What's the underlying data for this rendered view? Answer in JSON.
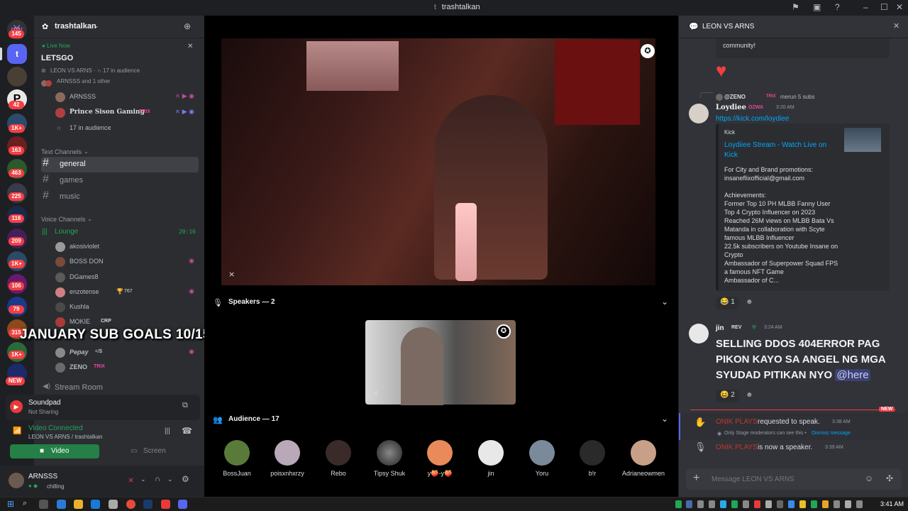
{
  "window": {
    "title": "trashtalkan",
    "controls": [
      "minimize-icon",
      "maximize-icon",
      "close-icon"
    ]
  },
  "server_rail": {
    "badges": [
      "145",
      "42",
      "1K+",
      "163",
      "463",
      "225",
      "116",
      "209",
      "1K+",
      "106",
      "79",
      "315",
      "1K+",
      "NEW"
    ],
    "colors": {
      "badge": "#f23f43",
      "active": "#5865f2"
    }
  },
  "sidebar": {
    "server_name": "trashtalkan",
    "live": {
      "label": "Live Now",
      "title": "LETSGO",
      "info": "LEON VS ARNS",
      "audience": "17 in audience",
      "speakers": "ARNSSS and 1 other"
    },
    "stage_users": [
      {
        "name": "ARNSSS"
      },
      {
        "name": "Prince Sison Gaming",
        "tag": "TRIX"
      }
    ],
    "stage_audience": "17 in audience",
    "text_channels_label": "Text Channels",
    "text_channels": [
      "general",
      "games",
      "music"
    ],
    "voice_channels_label": "Voice Channels",
    "lounge": {
      "name": "Lounge",
      "time": "20:16"
    },
    "voice_users": [
      {
        "name": "akosiviolet"
      },
      {
        "name": "BOSS DON"
      },
      {
        "name": "DGames8"
      },
      {
        "name": "enzotense",
        "extra": "767"
      },
      {
        "name": "Kushla"
      },
      {
        "name": "MOKIE",
        "tag": "CRP"
      },
      {
        "name": "Pepay",
        "extra": "</$"
      },
      {
        "name": "ZENO",
        "tag": "TRIX"
      }
    ],
    "stream_room": "Stream Room",
    "overlay_text": "JANUARY SUB GOALS 10/150"
  },
  "soundpad": {
    "title": "Soundpad",
    "status": "Not Sharing"
  },
  "connection": {
    "status": "Video Connected",
    "detail": "LEON VS ARNS / trashtalkan",
    "video_label": "Video",
    "screen_label": "Screen"
  },
  "user": {
    "name": "ARNSSS",
    "status": "chilling"
  },
  "stage": {
    "speakers_label": "Speakers — 2",
    "audience_label": "Audience — 17",
    "audience": [
      "BossJuan",
      "poisxnhxrzy",
      "Rebo",
      "Tipsy Shuk",
      "y🍑-y🍑",
      "jin",
      "Yoru",
      "b!r",
      "Adrianeowmen"
    ]
  },
  "chat": {
    "title": "LEON VS ARNS",
    "prev_text_1": "community!",
    "reply_ref": "@ZENO",
    "reply_tag": "TRIX",
    "reply_text": "merun 5 subs",
    "msg1": {
      "author": "Loydiee",
      "tag": "OZWA",
      "time": "3:20 AM",
      "link": "https://kick.com/loydiee"
    },
    "embed": {
      "provider": "Kick",
      "title": "Loydiiee Stream - Watch Live on Kick",
      "lines": [
        "For City and Brand promotions:",
        "insaneflixofficial@gmail.com",
        "",
        "Achievements:",
        "Former Top 10 PH MLBB Fanny User",
        "Top 4 Crypto Influencer on 2023",
        "Reached 26M views on MLBB Bata Vs",
        "Matanda in collaboration with Scyte",
        "famous MLBB Influencer",
        "22.5k subscribers on Youtube Insane on",
        "Crypto",
        "Ambassador of Superpower Squad FPS",
        "a famous NFT Game",
        "Ambassador of C..."
      ]
    },
    "reaction1": "1",
    "msg2": {
      "author": "jin",
      "tag": "REV",
      "time": "3:24 AM",
      "text": "SELLING DDOS 404ERROR PAG PIKON KAYO SA ANGEL NG MGA SYUDAD PITIKAN NYO",
      "mention": "@here"
    },
    "reaction2": "2",
    "new_badge": "NEW",
    "sys1": {
      "user": "ONIK PLAYS",
      "text": "requested to speak.",
      "time": "3:38 AM"
    },
    "sys1_note": "Only Stage moderators can see this •",
    "sys1_dismiss": "Dismiss message",
    "sys2": {
      "user": "ONIK PLAYS",
      "text": "is now a speaker.",
      "time": "3:39 AM"
    },
    "input_placeholder": "Message LEON VS ARNS"
  },
  "taskbar": {
    "clock": "3:41 AM"
  }
}
